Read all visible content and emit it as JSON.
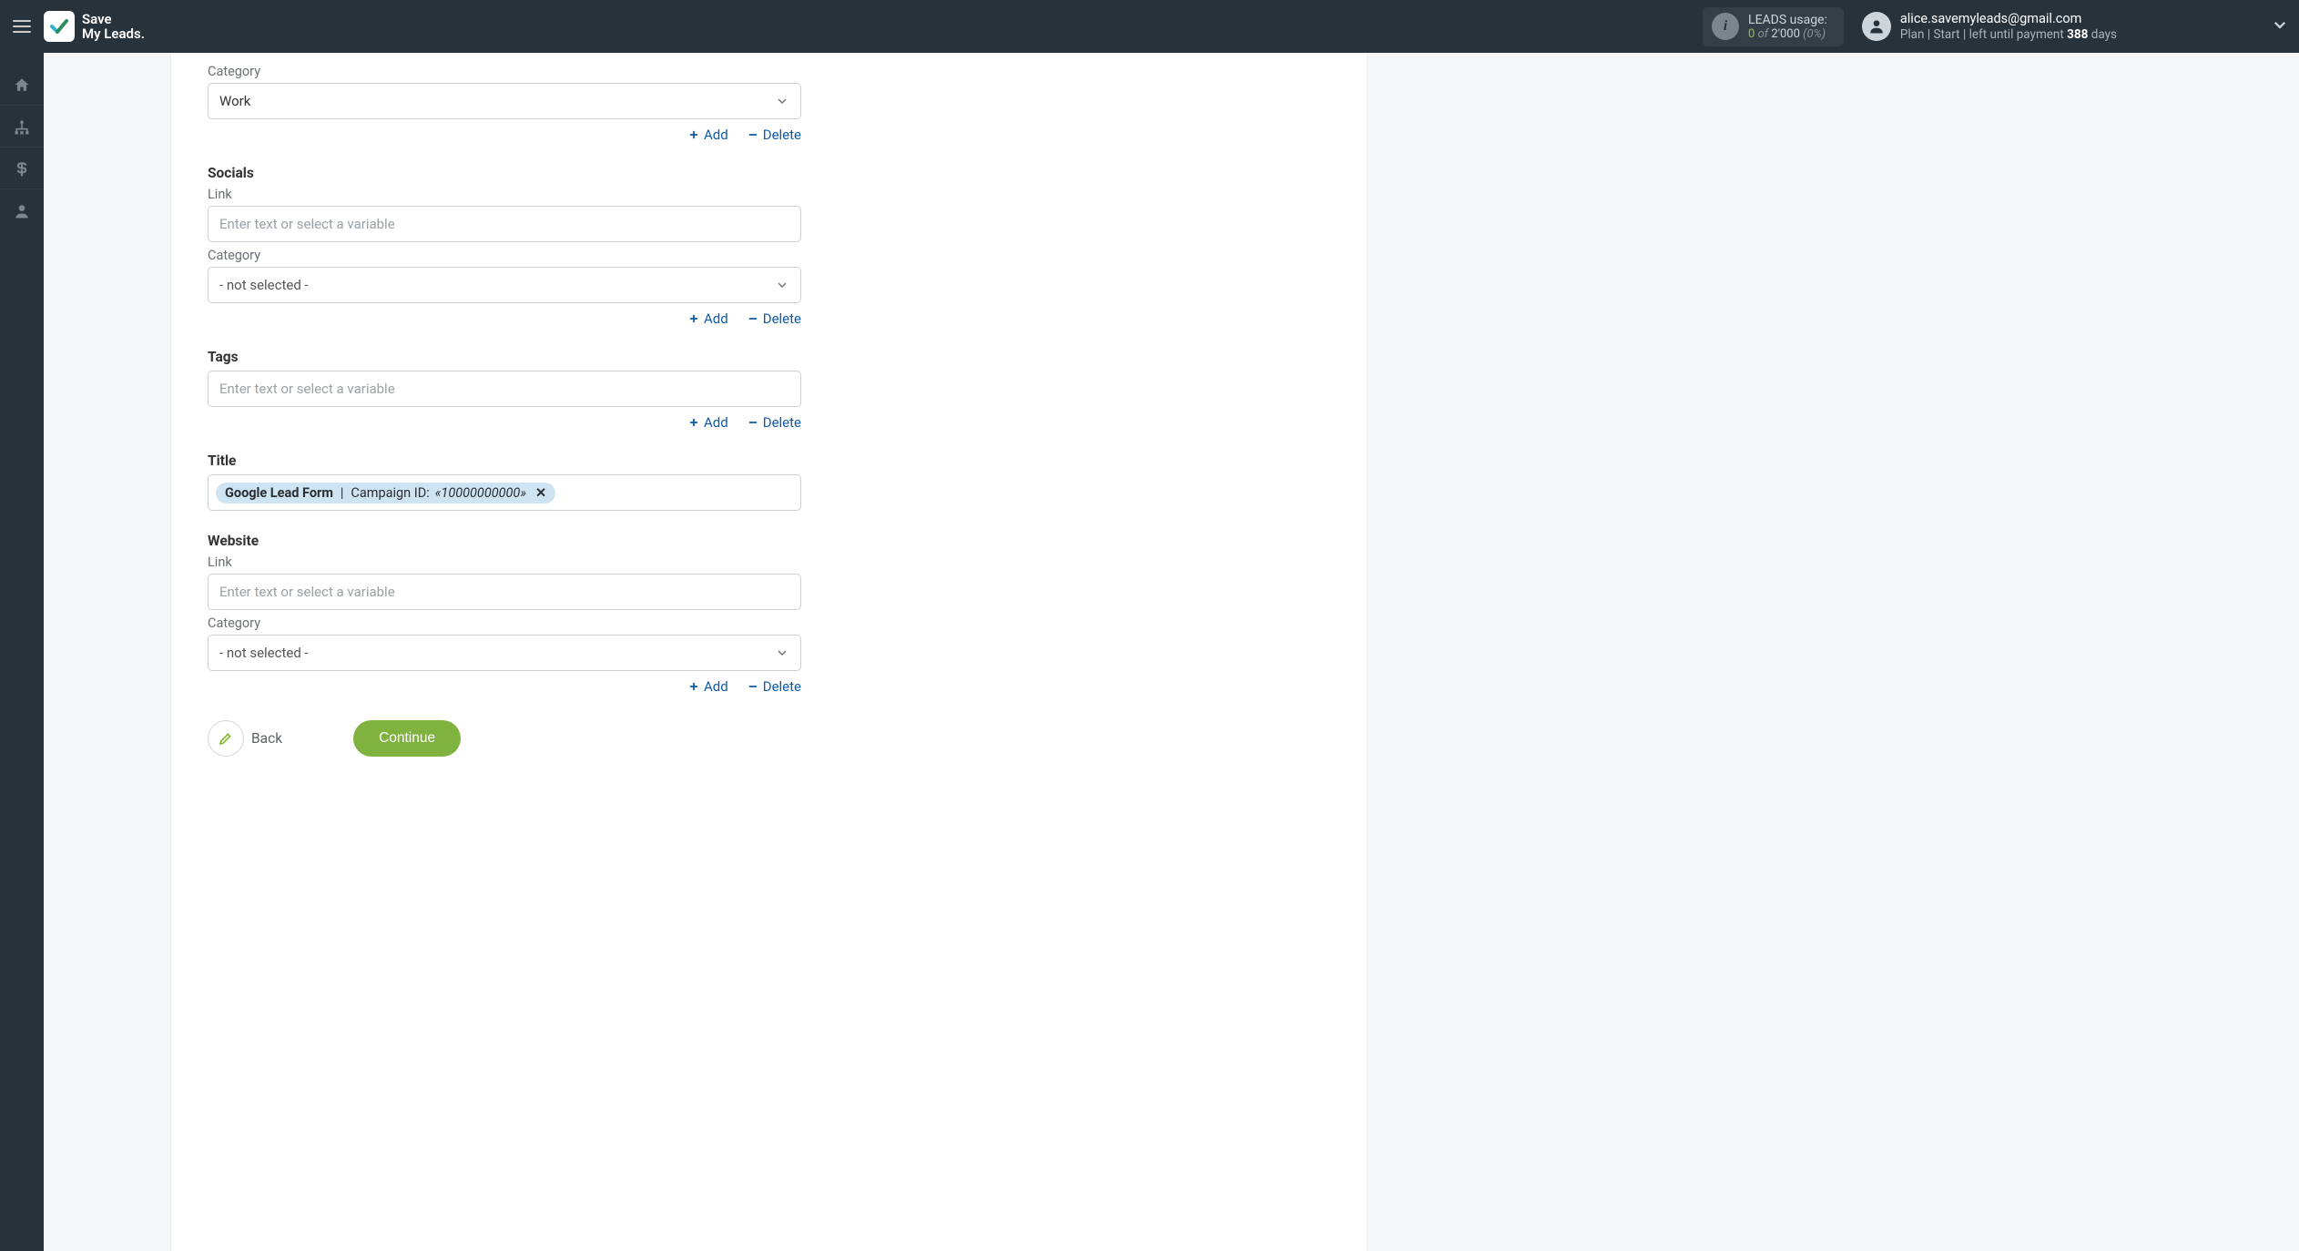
{
  "header": {
    "app_name_line1": "Save",
    "app_name_line2": "My Leads.",
    "usage": {
      "title": "LEADS usage:",
      "current": "0",
      "of": "of",
      "total": "2'000",
      "pct": "(0%)"
    },
    "account": {
      "email": "alice.savemyleads@gmail.com",
      "plan_prefix": "Plan |",
      "plan_name": "Start",
      "plan_mid": "| left until payment",
      "days": "388",
      "days_suffix": "days"
    }
  },
  "sections": {
    "category_top": {
      "label": "Category",
      "value": "Work"
    },
    "socials": {
      "heading": "Socials",
      "link_label": "Link",
      "link_placeholder": "Enter text or select a variable",
      "category_label": "Category",
      "category_value": "- not selected -"
    },
    "tags": {
      "heading": "Tags",
      "placeholder": "Enter text or select a variable"
    },
    "title": {
      "heading": "Title",
      "chip": {
        "source": "Google Lead Form",
        "sep": " | ",
        "label": "Campaign ID:",
        "value": "«10000000000»"
      }
    },
    "website": {
      "heading": "Website",
      "link_label": "Link",
      "link_placeholder": "Enter text or select a variable",
      "category_label": "Category",
      "category_value": "- not selected -"
    }
  },
  "common": {
    "add": "Add",
    "delete": "Delete",
    "back": "Back",
    "continue": "Continue"
  }
}
